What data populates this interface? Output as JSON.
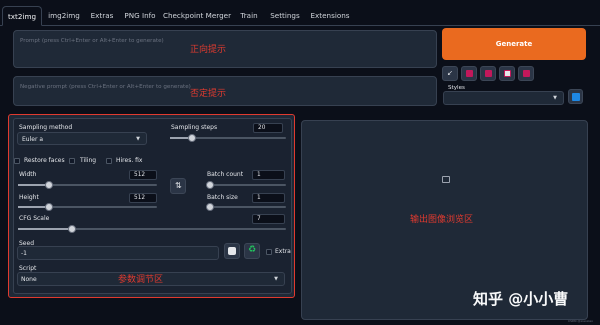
{
  "tabs": [
    "txt2img",
    "img2img",
    "Extras",
    "PNG Info",
    "Checkpoint Merger",
    "Train",
    "Settings",
    "Extensions"
  ],
  "prompt": {
    "placeholder": "Prompt (press Ctrl+Enter or Alt+Enter to generate)",
    "annotation": "正向提示"
  },
  "negative_prompt": {
    "placeholder": "Negative prompt (press Ctrl+Enter or Alt+Enter to generate)",
    "annotation": "否定提示"
  },
  "generate_label": "Generate",
  "tool_buttons": [
    {
      "name": "read-params-icon",
      "glyph": "↙"
    },
    {
      "name": "trash-icon",
      "color": "#c2185b"
    },
    {
      "name": "style-icon",
      "color": "#c2185b"
    },
    {
      "name": "clipboard-icon",
      "color": "#c2185b"
    },
    {
      "name": "save-style-icon",
      "color": "#c2185b"
    }
  ],
  "styles": {
    "label": "Styles",
    "value": ""
  },
  "params": {
    "annotation": "参数调节区",
    "sampling_method": {
      "label": "Sampling method",
      "value": "Euler a"
    },
    "sampling_steps": {
      "label": "Sampling steps",
      "value": "20",
      "fraction": 0.19
    },
    "checkboxes": [
      "Restore faces",
      "Tiling",
      "Hires. fix"
    ],
    "width": {
      "label": "Width",
      "value": "512",
      "fraction": 0.22
    },
    "height": {
      "label": "Height",
      "value": "512",
      "fraction": 0.22
    },
    "batch_count": {
      "label": "Batch count",
      "value": "1",
      "fraction": 0.0
    },
    "batch_size": {
      "label": "Batch size",
      "value": "1",
      "fraction": 0.0
    },
    "cfg_scale": {
      "label": "CFG Scale",
      "value": "7",
      "fraction": 0.2
    },
    "seed": {
      "label": "Seed",
      "value": "-1",
      "extra_label": "Extra"
    },
    "script": {
      "label": "Script",
      "value": "None"
    }
  },
  "output": {
    "annotation": "输出图像浏览区"
  },
  "watermark": "知乎 @小小曹",
  "tiny_text": "CSDN @xiaoxiao",
  "colors": {
    "accent": "#ea6a1f",
    "annotation": "#e03a2f",
    "background": "#0b0f19"
  }
}
